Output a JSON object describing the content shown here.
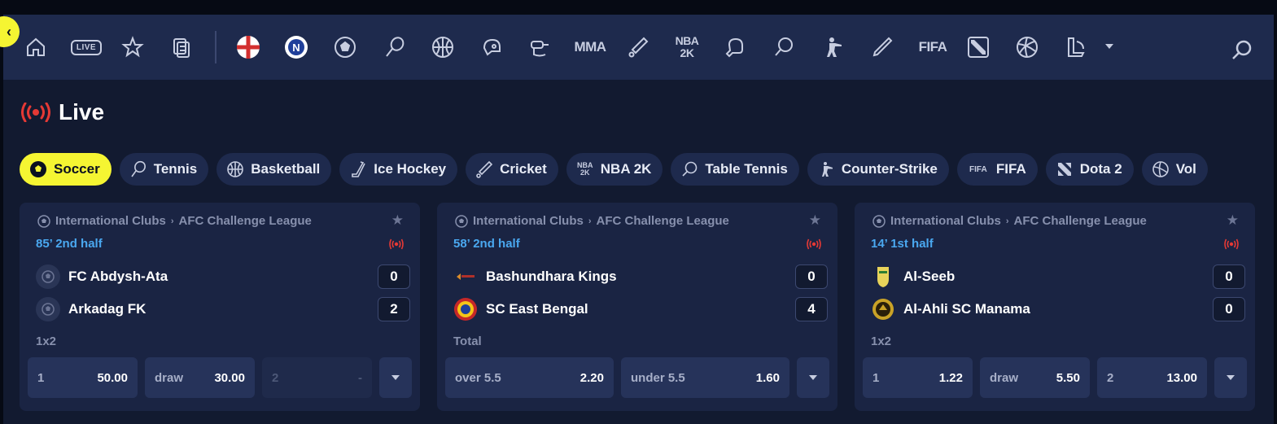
{
  "topnav": {
    "live_badge": "LIVE",
    "mma_label": "MMA",
    "nba_label": "NBA",
    "nba_sub": "2K",
    "fifa_label": "FIFA",
    "icons": [
      "home-icon",
      "live-icon",
      "favorites-icon",
      "betslip-icon",
      "england-flag-icon",
      "nations-league-icon",
      "soccer-icon",
      "tennis-icon",
      "basketball-icon",
      "ice-hockey-icon",
      "cricket-icon",
      "hockey-stick-icon",
      "mma-icon",
      "table-tennis-paddle-icon",
      "nba2k-icon",
      "boxing-icon",
      "table-tennis-icon",
      "counter-strike-icon",
      "baseball-icon",
      "fifa-icon",
      "dota2-icon",
      "volleyball-icon",
      "league-of-legends-icon",
      "search-icon"
    ]
  },
  "page": {
    "title": "Live"
  },
  "sports": [
    {
      "label": "Soccer",
      "icon": "soccer-ball-icon",
      "active": true
    },
    {
      "label": "Tennis",
      "icon": "tennis-icon",
      "active": false
    },
    {
      "label": "Basketball",
      "icon": "basketball-icon",
      "active": false
    },
    {
      "label": "Ice Hockey",
      "icon": "ice-hockey-icon",
      "active": false
    },
    {
      "label": "Cricket",
      "icon": "cricket-icon",
      "active": false
    },
    {
      "label": "NBA 2K",
      "icon": "nba2k-icon",
      "active": false
    },
    {
      "label": "Table Tennis",
      "icon": "table-tennis-icon",
      "active": false
    },
    {
      "label": "Counter-Strike",
      "icon": "counter-strike-icon",
      "active": false
    },
    {
      "label": "FIFA",
      "icon": "fifa-icon",
      "active": false
    },
    {
      "label": "Dota 2",
      "icon": "dota2-icon",
      "active": false
    },
    {
      "label": "Vol",
      "icon": "volleyball-icon",
      "active": false
    }
  ],
  "chip_icon_text": {
    "nba_top": "NBA",
    "nba_bottom": "2K",
    "fifa": "FIFA"
  },
  "matches": [
    {
      "category": "International Clubs",
      "league": "AFC Challenge League",
      "time": "85’ 2nd half",
      "home": {
        "name": "FC Abdysh-Ata",
        "score": "0"
      },
      "away": {
        "name": "Arkadag FK",
        "score": "2"
      },
      "market": "1x2",
      "odds": [
        {
          "label": "1",
          "value": "50.00"
        },
        {
          "label": "draw",
          "value": "30.00"
        },
        {
          "label": "2",
          "value": "-"
        }
      ]
    },
    {
      "category": "International Clubs",
      "league": "AFC Challenge League",
      "time": "58’ 2nd half",
      "home": {
        "name": "Bashundhara Kings",
        "score": "0"
      },
      "away": {
        "name": "SC East Bengal",
        "score": "4"
      },
      "market": "Total",
      "odds": [
        {
          "label": "over 5.5",
          "value": "2.20"
        },
        {
          "label": "under 5.5",
          "value": "1.60"
        }
      ]
    },
    {
      "category": "International Clubs",
      "league": "AFC Challenge League",
      "time": "14’ 1st half",
      "home": {
        "name": "Al-Seeb",
        "score": "0"
      },
      "away": {
        "name": "Al-Ahli SC Manama",
        "score": "0"
      },
      "market": "1x2",
      "odds": [
        {
          "label": "1",
          "value": "1.22"
        },
        {
          "label": "draw",
          "value": "5.50"
        },
        {
          "label": "2",
          "value": "13.00"
        }
      ]
    }
  ],
  "colors": {
    "accent": "#f5f532",
    "live_red": "#e53935",
    "time_blue": "#4aa8f0",
    "card_bg": "#1a2443",
    "nav_bg": "#1e2a4d"
  }
}
